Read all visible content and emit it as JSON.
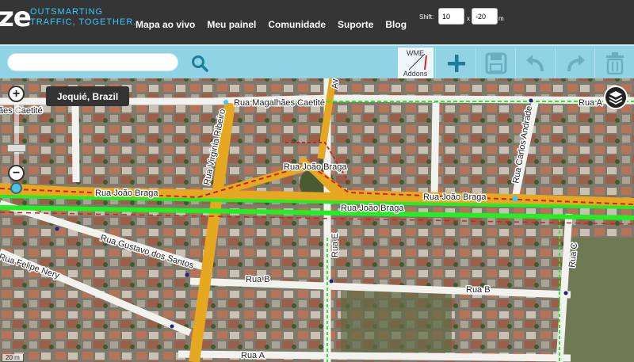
{
  "header": {
    "logo": "ze",
    "tagline_line1": "OUTSMARTING",
    "tagline_line2": "TRAFFIC, TOGETHER.",
    "nav": [
      "Mapa ao vivo",
      "Meu painel",
      "Comunidade",
      "Suporte",
      "Blog"
    ],
    "shift": {
      "label": "Shift:",
      "x_value": "10",
      "separator": "x",
      "y_value": "-20",
      "unit": "m"
    }
  },
  "toolbar": {
    "search_placeholder": "",
    "addon_line1": "WME",
    "addon_line2": "Addons",
    "icons": [
      "search-icon",
      "add-icon",
      "save-icon",
      "undo-icon",
      "redo-icon",
      "delete-icon"
    ]
  },
  "map": {
    "location": "Jequié, Brazil",
    "scale": "20 m",
    "streets": {
      "magalhaes_left": "ães Caetité",
      "magalhaes_center": "Rua Magalhães Caetité",
      "magalhaes_right": "Rua A",
      "virginia": "Rua Virginia Ribeiro",
      "joao_braga_1": "Rua João Braga",
      "joao_braga_2": "Rua João Braga",
      "joao_braga_3": "Rua João Braga",
      "joao_braga_4": "Rua João Braga",
      "carlos": "Rua Carlos Andrade",
      "gustavo": "Rua Gustavo dos Santos",
      "felipe": "Rua Felipe Nery",
      "rua_e": "Rua E",
      "rua_b_1": "Rua B",
      "rua_b_2": "Rua B",
      "rua_c": "Rua C",
      "rua_a_bottom": "Rua A",
      "av_top": "Av"
    },
    "colors": {
      "main_road": "#e6a820",
      "street": "#f0f0f0",
      "highlight_green": "#22ee22",
      "highlight_red": "#cc2222",
      "node": "#1a237e"
    }
  }
}
